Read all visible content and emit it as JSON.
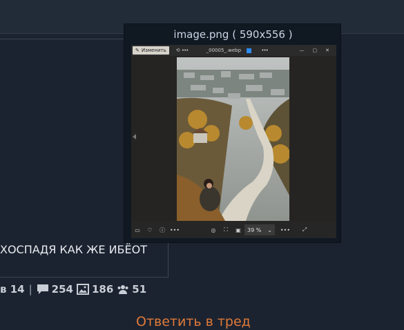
{
  "post": {
    "text": "ХОСПАДЯ КАК ЖЕ ИБЁОТ"
  },
  "stats": {
    "prefix": "в 14",
    "separator": "|",
    "posts": "254",
    "images": "186",
    "posters": "51",
    "icons": [
      "comment-icon",
      "image-icon",
      "users-icon"
    ]
  },
  "reply": {
    "label": "Ответить в тред",
    "color": "#e07a3a"
  },
  "popup": {
    "title": "image.png ( 590x556 )",
    "viewer": {
      "edit_label": "Изменить",
      "file_name": "_00005_.webp",
      "zoom": "39 %",
      "more": "•••"
    }
  }
}
